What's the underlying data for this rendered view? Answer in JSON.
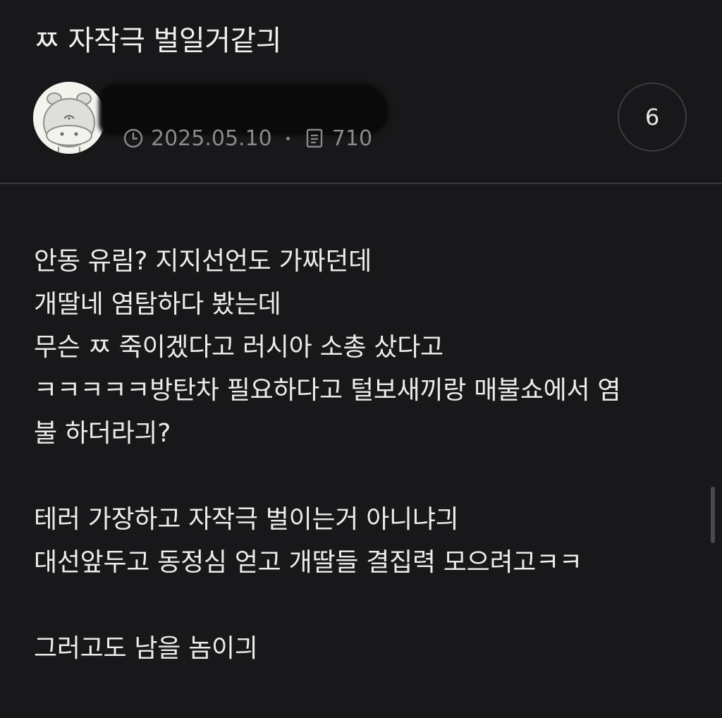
{
  "post": {
    "title": "ㅉ 자작극 벌일거같긔",
    "date": "2025.05.10",
    "views": "710",
    "comment_count": "6"
  },
  "icons": {
    "date": "clock-icon",
    "views": "document-icon",
    "author": "avatar-hippo-icon"
  },
  "content": {
    "lines": [
      "안동 유림? 지지선언도 가짜던데",
      "개딸네 염탐하다 봤는데",
      "무슨 ㅉ 죽이겠다고 러시아 소총 샀다고",
      "ㅋㅋㅋㅋㅋ방탄차 필요하다고 털보새끼랑 매불쇼에서 염",
      "불 하더라긔?",
      "",
      "테러 가장하고 자작극 벌이는거 아니냐긔",
      "대선앞두고 동정심 얻고 개딸들 결집력 모으려고ㅋㅋ",
      "",
      "그러고도 남을 놈이긔"
    ]
  },
  "colors": {
    "background": "#18181a",
    "text": "#ececec",
    "meta": "#8a8a8d",
    "divider": "#38383b"
  }
}
